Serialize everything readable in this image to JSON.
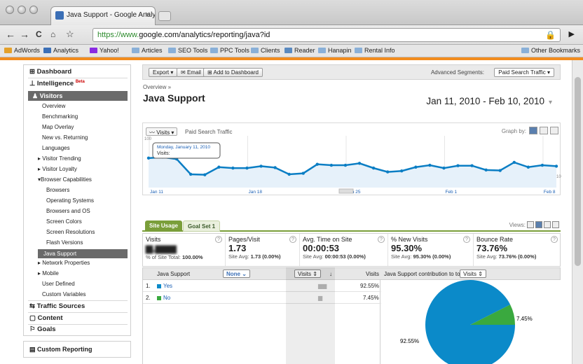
{
  "browser": {
    "tab_title": "Java Support - Google Analy",
    "url_https": "https://www.",
    "url_rest": "google.com/analytics/reporting/java?id",
    "bookmarks": [
      "AdWords",
      "Analytics",
      "Yahoo!",
      "Articles",
      "SEO Tools",
      "PPC Tools",
      "Clients",
      "Reader",
      "Hanapin",
      "Rental Info",
      "Other Bookmarks"
    ]
  },
  "sidebar": {
    "dashboard": "Dashboard",
    "intelligence": "Intelligence",
    "intelligence_badge": "Beta",
    "visitors": "Visitors",
    "items": [
      "Overview",
      "Benchmarking",
      "Map Overlay",
      "New vs. Returning",
      "Languages",
      "Visitor Trending",
      "Visitor Loyalty",
      "Browser Capabilities"
    ],
    "sub_items": [
      "Browsers",
      "Operating Systems",
      "Browsers and OS",
      "Screen Colors",
      "Screen Resolutions",
      "Flash Versions",
      "Java Support"
    ],
    "items2": [
      "Network Properties",
      "Mobile",
      "User Defined",
      "Custom Variables"
    ],
    "traffic_sources": "Traffic Sources",
    "content": "Content",
    "goals": "Goals",
    "custom_reporting": "Custom Reporting"
  },
  "toolbar": {
    "export": "Export",
    "email": "Email",
    "add_dashboard": "Add to Dashboard",
    "adv_segments": "Advanced Segments:",
    "segment_value": "Paid Search Traffic"
  },
  "header": {
    "breadcrumb": "Overview »",
    "title": "Java Support",
    "date_range": "Jan 11, 2010 - Feb 10, 2010"
  },
  "chart": {
    "metric_select": "Visits",
    "compare_label": "Paid Search Traffic",
    "graph_by": "Graph by:",
    "ytick_left": "100",
    "ytick_right": "100",
    "tooltip_date": "Monday, January 11, 2010",
    "tooltip_visits": "Visits:",
    "xticks": [
      "Jan 11",
      "Jan 18",
      "Jan 25",
      "Feb 1",
      "Feb 8"
    ]
  },
  "chart_data": {
    "type": "line",
    "series": [
      {
        "name": "Visits",
        "values": [
          62,
          64,
          60,
          28,
          27,
          43,
          41,
          41,
          45,
          42,
          28,
          30,
          49,
          47,
          47,
          51,
          41,
          33,
          35,
          43,
          47,
          41,
          46,
          46,
          37,
          36,
          53,
          43,
          47,
          45
        ]
      }
    ],
    "ylim": [
      0,
      100
    ],
    "xticks": [
      "Jan 11",
      "Jan 18",
      "Jan 25",
      "Feb 1",
      "Feb 8"
    ]
  },
  "tabs": {
    "site_usage": "Site Usage",
    "goal_set": "Goal Set 1",
    "views": "Views:"
  },
  "metrics": [
    {
      "label": "Visits",
      "value": "",
      "sub_label": "% of Site Total:",
      "sub_value": "100.00%"
    },
    {
      "label": "Pages/Visit",
      "value": "1.73",
      "sub_label": "Site Avg:",
      "sub_value": "1.73 (0.00%)"
    },
    {
      "label": "Avg. Time on Site",
      "value": "00:00:53",
      "sub_label": "Site Avg:",
      "sub_value": "00:00:53 (0.00%)"
    },
    {
      "label": "% New Visits",
      "value": "95.30%",
      "sub_label": "Site Avg:",
      "sub_value": "95.30% (0.00%)"
    },
    {
      "label": "Bounce Rate",
      "value": "73.76%",
      "sub_label": "Site Avg:",
      "sub_value": "73.76% (0.00%)"
    }
  ],
  "table": {
    "col_dimension": "Java Support",
    "none_select": "None",
    "visits_select": "Visits",
    "col_visits": "Visits",
    "contribution": "Java Support contribution to total:",
    "contribution_select": "Visits",
    "rows": [
      {
        "num": "1.",
        "label": "Yes",
        "pct": "92.55%",
        "color": "#0b8ac9"
      },
      {
        "num": "2.",
        "label": "No",
        "pct": "7.45%",
        "color": "#3aa93f"
      }
    ]
  },
  "pie_data": {
    "type": "pie",
    "slices": [
      {
        "label": "Yes",
        "value": 92.55,
        "color": "#0b8ac9",
        "text": "92.55%"
      },
      {
        "label": "No",
        "value": 7.45,
        "color": "#3aa93f",
        "text": "7.45%"
      }
    ]
  }
}
